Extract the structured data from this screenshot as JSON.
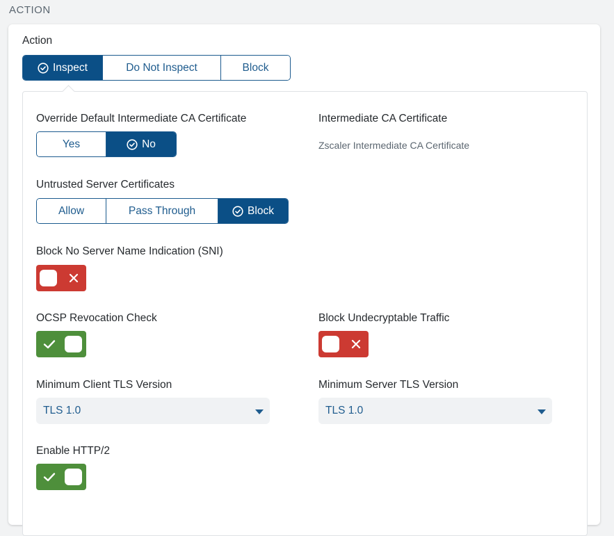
{
  "section": {
    "title": "ACTION"
  },
  "action": {
    "label": "Action",
    "options": [
      "Inspect",
      "Do Not Inspect",
      "Block"
    ],
    "selected": "Inspect"
  },
  "override_ca": {
    "label": "Override Default Intermediate CA Certificate",
    "options": [
      "Yes",
      "No"
    ],
    "selected": "No"
  },
  "intermediate_ca": {
    "label": "Intermediate CA Certificate",
    "value": "Zscaler Intermediate CA Certificate"
  },
  "untrusted": {
    "label": "Untrusted Server Certificates",
    "options": [
      "Allow",
      "Pass Through",
      "Block"
    ],
    "selected": "Block"
  },
  "block_sni": {
    "label": "Block No Server Name Indication (SNI)",
    "state": "off"
  },
  "ocsp": {
    "label": "OCSP Revocation Check",
    "state": "on"
  },
  "block_undecryptable": {
    "label": "Block Undecryptable Traffic",
    "state": "off"
  },
  "min_client_tls": {
    "label": "Minimum Client TLS Version",
    "value": "TLS 1.0"
  },
  "min_server_tls": {
    "label": "Minimum Server TLS Version",
    "value": "TLS 1.0"
  },
  "http2": {
    "label": "Enable HTTP/2",
    "state": "on"
  },
  "colors": {
    "primary": "#0b4f86",
    "toggle_on": "#4e8f3b",
    "toggle_off": "#cc3a32"
  },
  "icons": {
    "selected": "check-circle-icon",
    "on": "check-icon",
    "off": "close-icon",
    "dropdown": "caret-down-icon"
  }
}
